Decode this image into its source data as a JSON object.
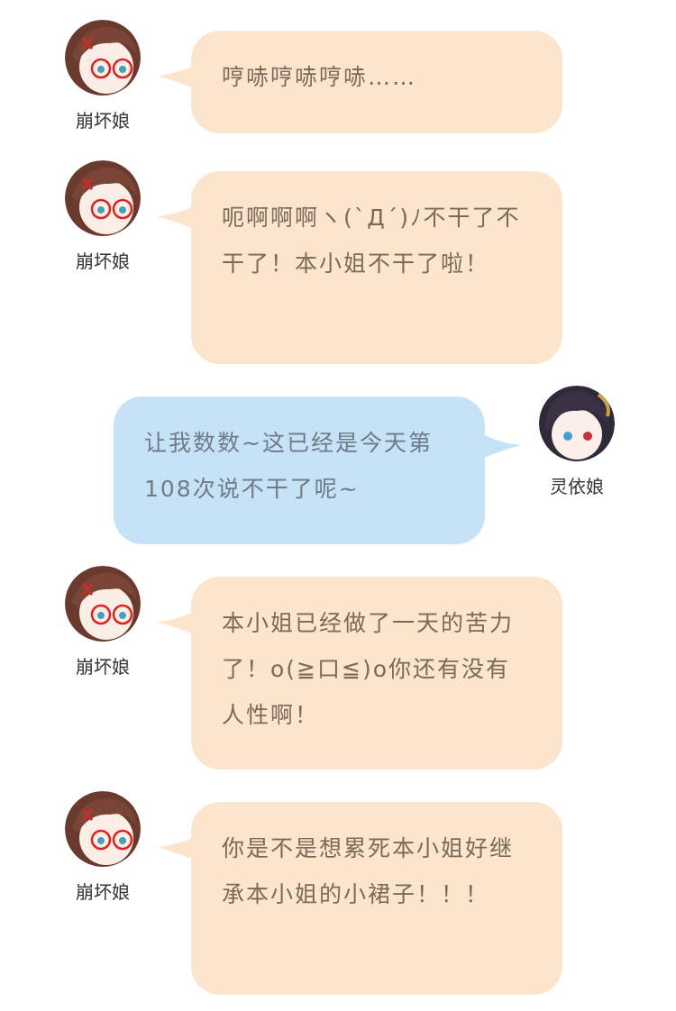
{
  "messages": [
    {
      "speaker": "崩坏娘",
      "side": "left",
      "text": "哼哧哼哧哼哧……"
    },
    {
      "speaker": "崩坏娘",
      "side": "left",
      "text": "呃啊啊啊ヽ(`Д´)ﾉ不干了不干了！本小姐不干了啦！"
    },
    {
      "speaker": "灵依娘",
      "side": "right",
      "text": "让我数数~这已经是今天第108次说不干了呢~"
    },
    {
      "speaker": "崩坏娘",
      "side": "left",
      "text": "本小姐已经做了一天的苦力了！o(≧口≦)o你还有没有人性啊！"
    },
    {
      "speaker": "崩坏娘",
      "side": "left",
      "text": "你是不是想累死本小姐好继承本小姐的小裙子！！！"
    }
  ],
  "colors": {
    "left_bubble": "#fbe5cc",
    "right_bubble": "#c6e2f6",
    "name_text": "#333333"
  },
  "icons": {
    "left_avatar": "anime-girl-brown-hair-glasses-avatar-icon",
    "right_avatar": "anime-girl-dark-hair-avatar-icon"
  }
}
